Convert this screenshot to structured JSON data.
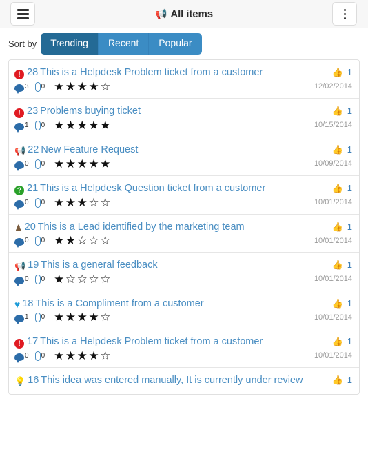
{
  "topbar": {
    "menu_icon": "hamburger-icon",
    "title": "All items",
    "title_icon": "megaphone-icon",
    "more_icon": "kebab-menu-icon"
  },
  "sort": {
    "label": "Sort by",
    "options": [
      {
        "label": "Trending",
        "active": true
      },
      {
        "label": "Recent",
        "active": false
      },
      {
        "label": "Popular",
        "active": false
      }
    ]
  },
  "colors": {
    "accent_blue": "#4a8ec2",
    "active_tab": "#246a95",
    "tab": "#3b8cc4",
    "problem_red": "#e01b22",
    "question_green": "#2aa12a",
    "megaphone_orange": "#f0942b",
    "heart_blue": "#1b9bd8",
    "idea_yellow": "#f5dd5b",
    "date_grey": "#9a9a9a"
  },
  "items": [
    {
      "type_icon": "problem-icon",
      "number": "28",
      "title": "This is a Helpdesk Problem ticket from a customer",
      "comments": "3",
      "attachments": "0",
      "rating": 4,
      "likes": "1",
      "date": "12/02/2014"
    },
    {
      "type_icon": "problem-icon",
      "number": "23",
      "title": "Problems buying ticket",
      "comments": "1",
      "attachments": "0",
      "rating": 5,
      "likes": "1",
      "date": "10/15/2014"
    },
    {
      "type_icon": "megaphone-icon",
      "number": "22",
      "title": "New Feature Request",
      "comments": "0",
      "attachments": "0",
      "rating": 5,
      "likes": "1",
      "date": "10/09/2014"
    },
    {
      "type_icon": "question-icon",
      "number": "21",
      "title": "This is a Helpdesk Question ticket from a customer",
      "comments": "0",
      "attachments": "0",
      "rating": 3,
      "likes": "1",
      "date": "10/01/2014"
    },
    {
      "type_icon": "lead-trophy-icon",
      "number": "20",
      "title": "This is a Lead identified by the marketing team",
      "comments": "0",
      "attachments": "0",
      "rating": 2,
      "likes": "1",
      "date": "10/01/2014"
    },
    {
      "type_icon": "megaphone-icon",
      "number": "19",
      "title": "This is a general feedback",
      "comments": "0",
      "attachments": "0",
      "rating": 1,
      "likes": "1",
      "date": "10/01/2014"
    },
    {
      "type_icon": "heart-icon",
      "number": "18",
      "title": "This is a Compliment from a customer",
      "comments": "1",
      "attachments": "0",
      "rating": 4,
      "likes": "1",
      "date": "10/01/2014"
    },
    {
      "type_icon": "problem-icon",
      "number": "17",
      "title": "This is a Helpdesk Problem ticket from a customer",
      "comments": "0",
      "attachments": "0",
      "rating": 4,
      "likes": "1",
      "date": "10/01/2014"
    },
    {
      "type_icon": "idea-bulb-icon",
      "number": "16",
      "title": "This idea was entered manually, It is currently under review",
      "comments": "",
      "attachments": "",
      "rating": 0,
      "likes": "1",
      "date": ""
    }
  ]
}
